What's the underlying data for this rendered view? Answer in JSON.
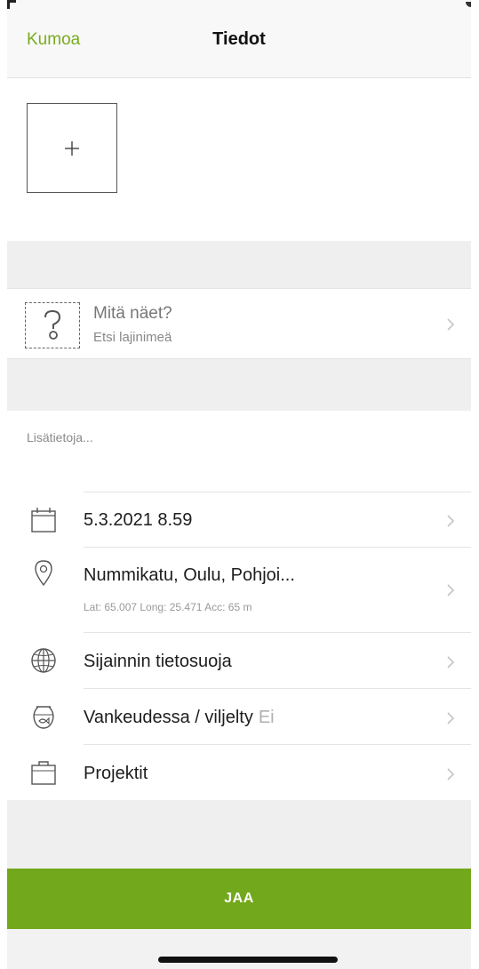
{
  "navbar": {
    "cancel_label": "Kumoa",
    "title": "Tiedot"
  },
  "photo": {
    "add_symbol": "+"
  },
  "species": {
    "title": "Mitä näet?",
    "subtitle": "Etsi lajinimeä",
    "icon": "question-icon"
  },
  "notes": {
    "placeholder": "Lisätietoja..."
  },
  "details": {
    "date": {
      "label": "5.3.2021 8.59",
      "icon": "calendar-icon"
    },
    "location": {
      "label": "Nummikatu, Oulu, Pohjoi...",
      "coords": "Lat: 65.007  Long: 25.471  Acc: 65 m",
      "icon": "location-pin-icon"
    },
    "privacy": {
      "label": "Sijainnin tietosuoja",
      "icon": "globe-icon"
    },
    "captive": {
      "label": "Vankeudessa / viljelty",
      "value": "Ei",
      "icon": "fishbowl-icon"
    },
    "projects": {
      "label": "Projektit",
      "icon": "briefcase-icon"
    }
  },
  "share_button": {
    "label": "JAA"
  },
  "colors": {
    "accent": "#72a81b",
    "cancel": "#7aab1e",
    "background_gap": "#efefef"
  }
}
